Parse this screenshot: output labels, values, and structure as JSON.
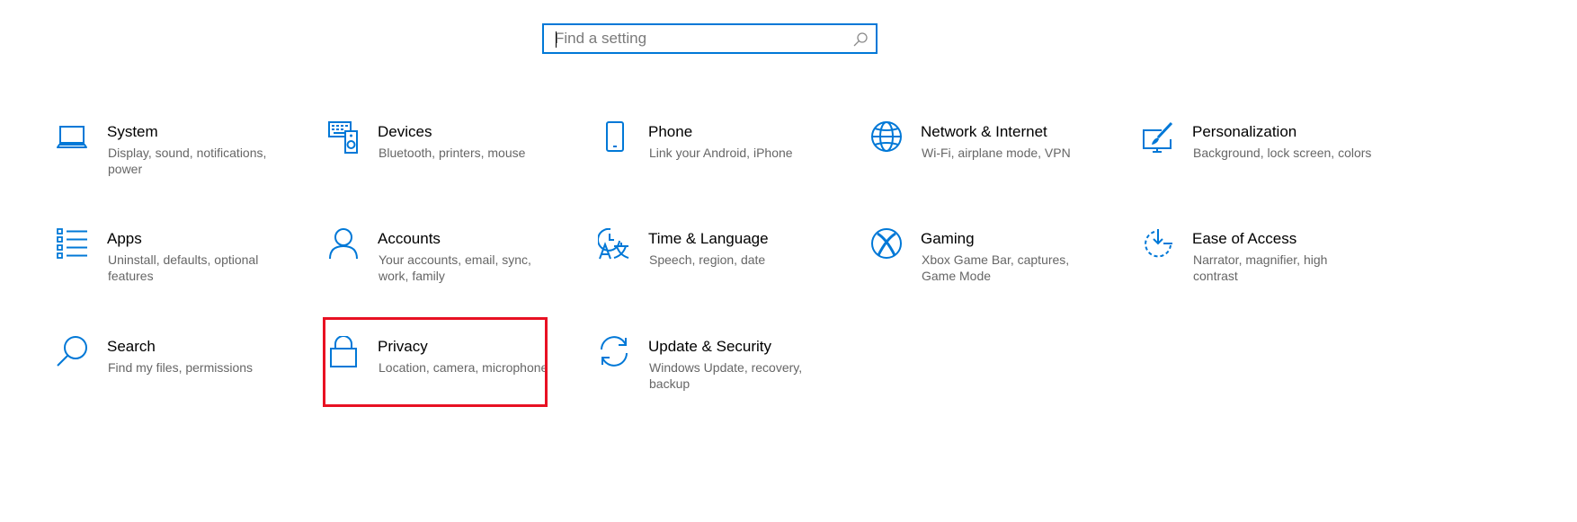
{
  "search": {
    "placeholder": "Find a setting",
    "value": ""
  },
  "accent_color": "#0078d7",
  "highlight_color": "#e81123",
  "tiles": [
    {
      "icon": "laptop-icon",
      "title": "System",
      "description": "Display, sound, notifications, power"
    },
    {
      "icon": "devices-icon",
      "title": "Devices",
      "description": "Bluetooth, printers, mouse"
    },
    {
      "icon": "phone-icon",
      "title": "Phone",
      "description": "Link your Android, iPhone"
    },
    {
      "icon": "globe-icon",
      "title": "Network & Internet",
      "description": "Wi-Fi, airplane mode, VPN"
    },
    {
      "icon": "personalization-icon",
      "title": "Personalization",
      "description": "Background, lock screen, colors"
    },
    {
      "icon": "apps-icon",
      "title": "Apps",
      "description": "Uninstall, defaults, optional features"
    },
    {
      "icon": "person-icon",
      "title": "Accounts",
      "description": "Your accounts, email, sync, work, family"
    },
    {
      "icon": "time-language-icon",
      "title": "Time & Language",
      "description": "Speech, region, date"
    },
    {
      "icon": "xbox-icon",
      "title": "Gaming",
      "description": "Xbox Game Bar, captures, Game Mode"
    },
    {
      "icon": "ease-of-access-icon",
      "title": "Ease of Access",
      "description": "Narrator, magnifier, high contrast"
    },
    {
      "icon": "search-icon",
      "title": "Search",
      "description": "Find my files, permissions"
    },
    {
      "icon": "lock-icon",
      "title": "Privacy",
      "description": "Location, camera, microphone"
    },
    {
      "icon": "sync-icon",
      "title": "Update & Security",
      "description": "Windows Update, recovery, backup"
    }
  ]
}
